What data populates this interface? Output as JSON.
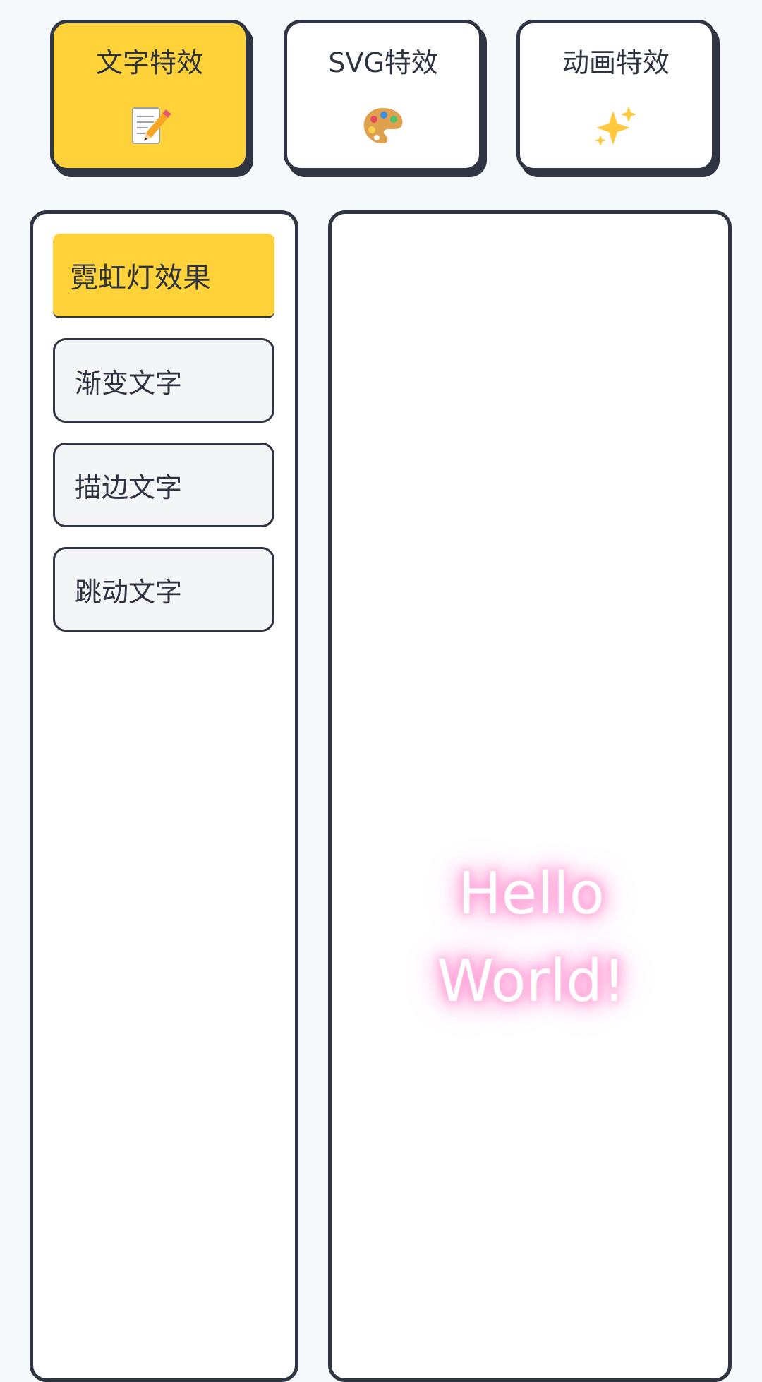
{
  "tabs": [
    {
      "label": "文字特效",
      "icon": "memo-pencil-icon",
      "active": true
    },
    {
      "label": "SVG特效",
      "icon": "artist-palette-icon",
      "active": false
    },
    {
      "label": "动画特效",
      "icon": "sparkles-icon",
      "active": false
    }
  ],
  "effects": [
    {
      "label": "霓虹灯效果",
      "active": true
    },
    {
      "label": "渐变文字",
      "active": false
    },
    {
      "label": "描边文字",
      "active": false
    },
    {
      "label": "跳动文字",
      "active": false
    }
  ],
  "preview": {
    "line1": "Hello",
    "line2": "World!"
  },
  "colors": {
    "accent": "#ffd23a",
    "border": "#2f3542",
    "neon_glow": "#ff8fd0",
    "background": "#f6f9fc"
  }
}
